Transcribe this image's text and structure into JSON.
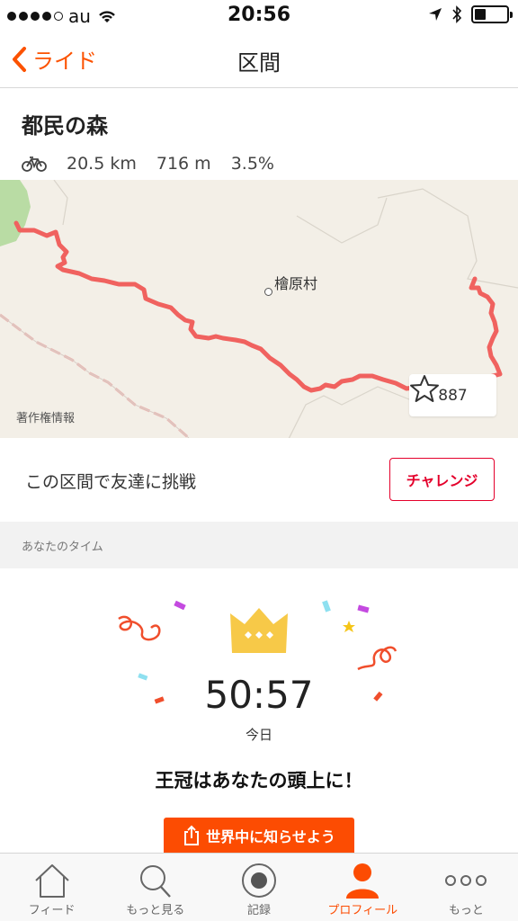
{
  "status_bar": {
    "carrier": "au",
    "time": "20:56"
  },
  "nav": {
    "back_label": "ライド",
    "title": "区間"
  },
  "segment": {
    "name": "都民の森",
    "distance": "20.5 km",
    "elevation": "716 m",
    "grade": "3.5%"
  },
  "map": {
    "place_name": "檜原村",
    "credit": "著作権情報",
    "star_count": "887"
  },
  "challenge": {
    "text": "この区間で友達に挑戦",
    "button_label": "チャレンジ"
  },
  "your_time": {
    "section_label": "あなたのタイム",
    "time": "50:57",
    "date": "今日",
    "message": "王冠はあなたの頭上に！",
    "share_label": "世界中に知らせよう"
  },
  "tabs": [
    {
      "label": "フィード",
      "icon": "home-icon"
    },
    {
      "label": "もっと見る",
      "icon": "search-icon"
    },
    {
      "label": "記録",
      "icon": "record-icon"
    },
    {
      "label": "プロフィール",
      "icon": "profile-icon"
    },
    {
      "label": "もっと",
      "icon": "more-icon"
    }
  ],
  "colors": {
    "accent": "#fc4c02",
    "route": "#f0625f",
    "challenge": "#e4002b",
    "crown": "#f7c948"
  }
}
